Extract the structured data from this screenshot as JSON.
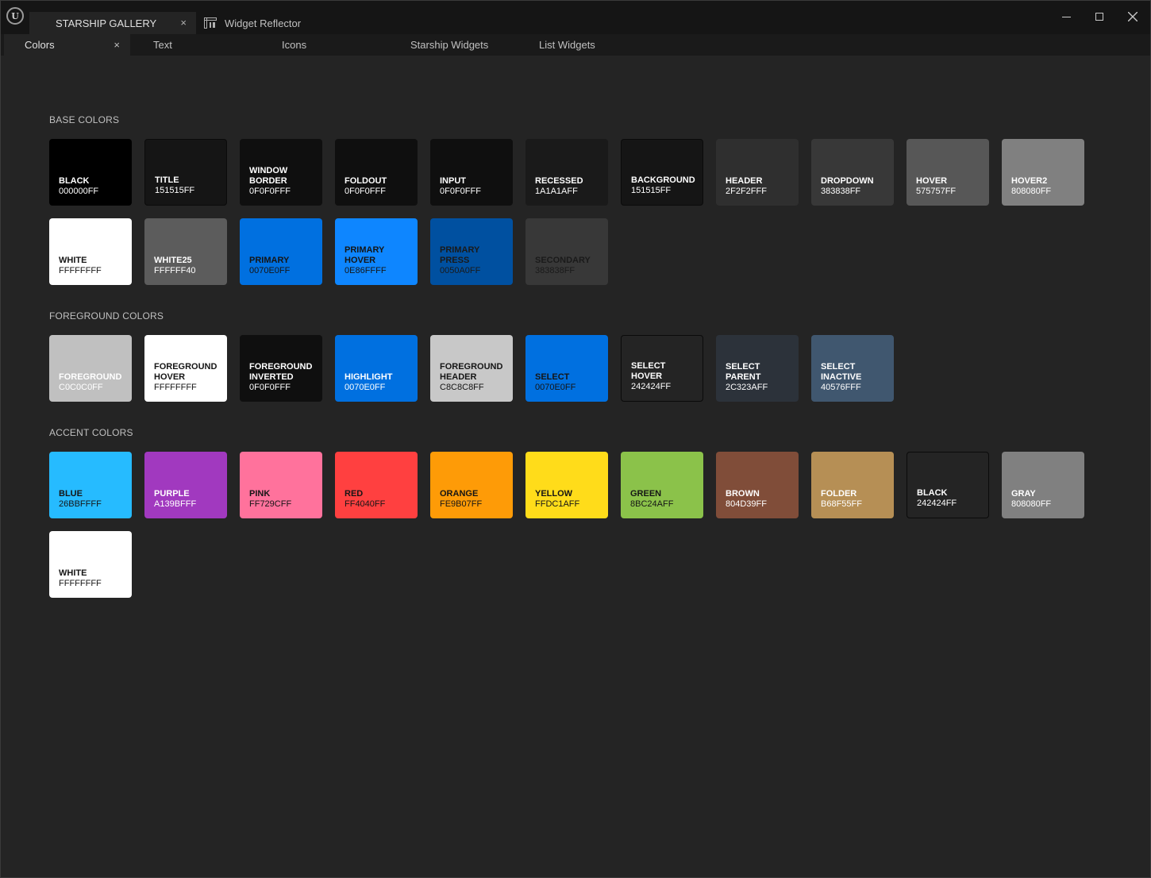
{
  "window": {
    "tabs": [
      {
        "label": "STARSHIP GALLERY",
        "active": true
      },
      {
        "label": "Widget Reflector",
        "active": false
      }
    ],
    "close_glyph": "×",
    "logo_text": "U"
  },
  "subtabs": [
    {
      "label": "Colors",
      "active": true
    },
    {
      "label": "Text"
    },
    {
      "label": "Icons"
    },
    {
      "label": "Starship Widgets"
    },
    {
      "label": "List Widgets"
    }
  ],
  "sections": [
    {
      "title": "BASE COLORS",
      "swatches": [
        {
          "name": "BLACK",
          "hex": "000000FF",
          "fill": "#000000"
        },
        {
          "name": "TITLE",
          "hex": "151515FF",
          "fill": "#151515"
        },
        {
          "name": "WINDOW\nBORDER",
          "hex": "0F0F0FFF",
          "fill": "#0f0f0f"
        },
        {
          "name": "FOLDOUT",
          "hex": "0F0F0FFF",
          "fill": "#0f0f0f"
        },
        {
          "name": "INPUT",
          "hex": "0F0F0FFF",
          "fill": "#0f0f0f"
        },
        {
          "name": "RECESSED",
          "hex": "1A1A1AFF",
          "fill": "#1a1a1a"
        },
        {
          "name": "BACKGROUND",
          "hex": "151515FF",
          "fill": "#151515"
        },
        {
          "name": "HEADER",
          "hex": "2F2F2FFF",
          "fill": "#2f2f2f"
        },
        {
          "name": "DROPDOWN",
          "hex": "383838FF",
          "fill": "#383838"
        },
        {
          "name": "HOVER",
          "hex": "575757FF",
          "fill": "#575757"
        },
        {
          "name": "HOVER2",
          "hex": "808080FF",
          "fill": "#808080"
        },
        {
          "name": "WHITE",
          "hex": "FFFFFFFF",
          "fill": "#ffffff",
          "text": "dark"
        },
        {
          "name": "WHITE25",
          "hex": "FFFFFF40",
          "fill": "#5c5c5c"
        },
        {
          "name": "PRIMARY",
          "hex": "0070E0FF",
          "fill": "#0070e0",
          "text": "dark"
        },
        {
          "name": "PRIMARY\nHOVER",
          "hex": "0E86FFFF",
          "fill": "#0e86ff",
          "text": "dark"
        },
        {
          "name": "PRIMARY\nPRESS",
          "hex": "0050A0FF",
          "fill": "#0050a0",
          "text": "dim"
        },
        {
          "name": "SECONDARY",
          "hex": "383838FF",
          "fill": "#383838",
          "text": "dim"
        }
      ]
    },
    {
      "title": "FOREGROUND COLORS",
      "swatches": [
        {
          "name": "FOREGROUND",
          "hex": "C0C0C0FF",
          "fill": "#c0c0c0"
        },
        {
          "name": "FOREGROUND\nHOVER",
          "hex": "FFFFFFFF",
          "fill": "#ffffff",
          "text": "dark"
        },
        {
          "name": "FOREGROUND\nINVERTED",
          "hex": "0F0F0FFF",
          "fill": "#0f0f0f"
        },
        {
          "name": "HIGHLIGHT",
          "hex": "0070E0FF",
          "fill": "#0070e0"
        },
        {
          "name": "FOREGROUND\nHEADER",
          "hex": "C8C8C8FF",
          "fill": "#c8c8c8",
          "text": "dark"
        },
        {
          "name": "SELECT",
          "hex": "0070E0FF",
          "fill": "#0070e0",
          "text": "dark"
        },
        {
          "name": "SELECT\nHOVER",
          "hex": "242424FF",
          "fill": "#242424"
        },
        {
          "name": "SELECT\nPARENT",
          "hex": "2C323AFF",
          "fill": "#2c323a"
        },
        {
          "name": "SELECT\nINACTIVE",
          "hex": "40576FFF",
          "fill": "#40576f"
        }
      ]
    },
    {
      "title": "ACCENT COLORS",
      "swatches": [
        {
          "name": "BLUE",
          "hex": "26BBFFFF",
          "fill": "#26bbff",
          "text": "dark"
        },
        {
          "name": "PURPLE",
          "hex": "A139BFFF",
          "fill": "#a139bf"
        },
        {
          "name": "PINK",
          "hex": "FF729CFF",
          "fill": "#ff729c",
          "text": "dark"
        },
        {
          "name": "RED",
          "hex": "FF4040FF",
          "fill": "#ff4040",
          "text": "dark"
        },
        {
          "name": "ORANGE",
          "hex": "FE9B07FF",
          "fill": "#fe9b07",
          "text": "dark"
        },
        {
          "name": "YELLOW",
          "hex": "FFDC1AFF",
          "fill": "#ffdc1a",
          "text": "dark"
        },
        {
          "name": "GREEN",
          "hex": "8BC24AFF",
          "fill": "#8bc24a",
          "text": "dark"
        },
        {
          "name": "BROWN",
          "hex": "804D39FF",
          "fill": "#804d39"
        },
        {
          "name": "FOLDER",
          "hex": "B68F55FF",
          "fill": "#b68f55"
        },
        {
          "name": "BLACK",
          "hex": "242424FF",
          "fill": "#242424"
        },
        {
          "name": "GRAY",
          "hex": "808080FF",
          "fill": "#808080"
        },
        {
          "name": "WHITE",
          "hex": "FFFFFFFF",
          "fill": "#ffffff",
          "text": "dark"
        }
      ]
    }
  ]
}
